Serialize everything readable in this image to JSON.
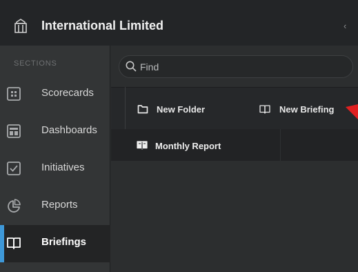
{
  "org": {
    "name": "International Limited",
    "icon": "building-columns-icon",
    "collapse_glyph": "‹"
  },
  "sidebar": {
    "section_title": "SECTIONS",
    "items": [
      {
        "label": "Scorecards",
        "icon": "scorecard-icon",
        "active": false
      },
      {
        "label": "Dashboards",
        "icon": "dashboard-icon",
        "active": false
      },
      {
        "label": "Initiatives",
        "icon": "checkbox-icon",
        "active": false
      },
      {
        "label": "Reports",
        "icon": "pie-chart-icon",
        "active": false
      },
      {
        "label": "Briefings",
        "icon": "book-icon",
        "active": true
      }
    ]
  },
  "search": {
    "placeholder": "Find",
    "value": "",
    "icon": "search-icon"
  },
  "actions": {
    "new_folder": {
      "label": "New Folder",
      "icon": "folder-icon"
    },
    "new_briefing": {
      "label": "New Briefing",
      "icon": "open-book-icon"
    }
  },
  "briefings": [
    {
      "label": "Monthly Report",
      "icon": "book-icon"
    }
  ],
  "colors": {
    "accent": "#3e98d8",
    "pointer": "#e02020"
  }
}
